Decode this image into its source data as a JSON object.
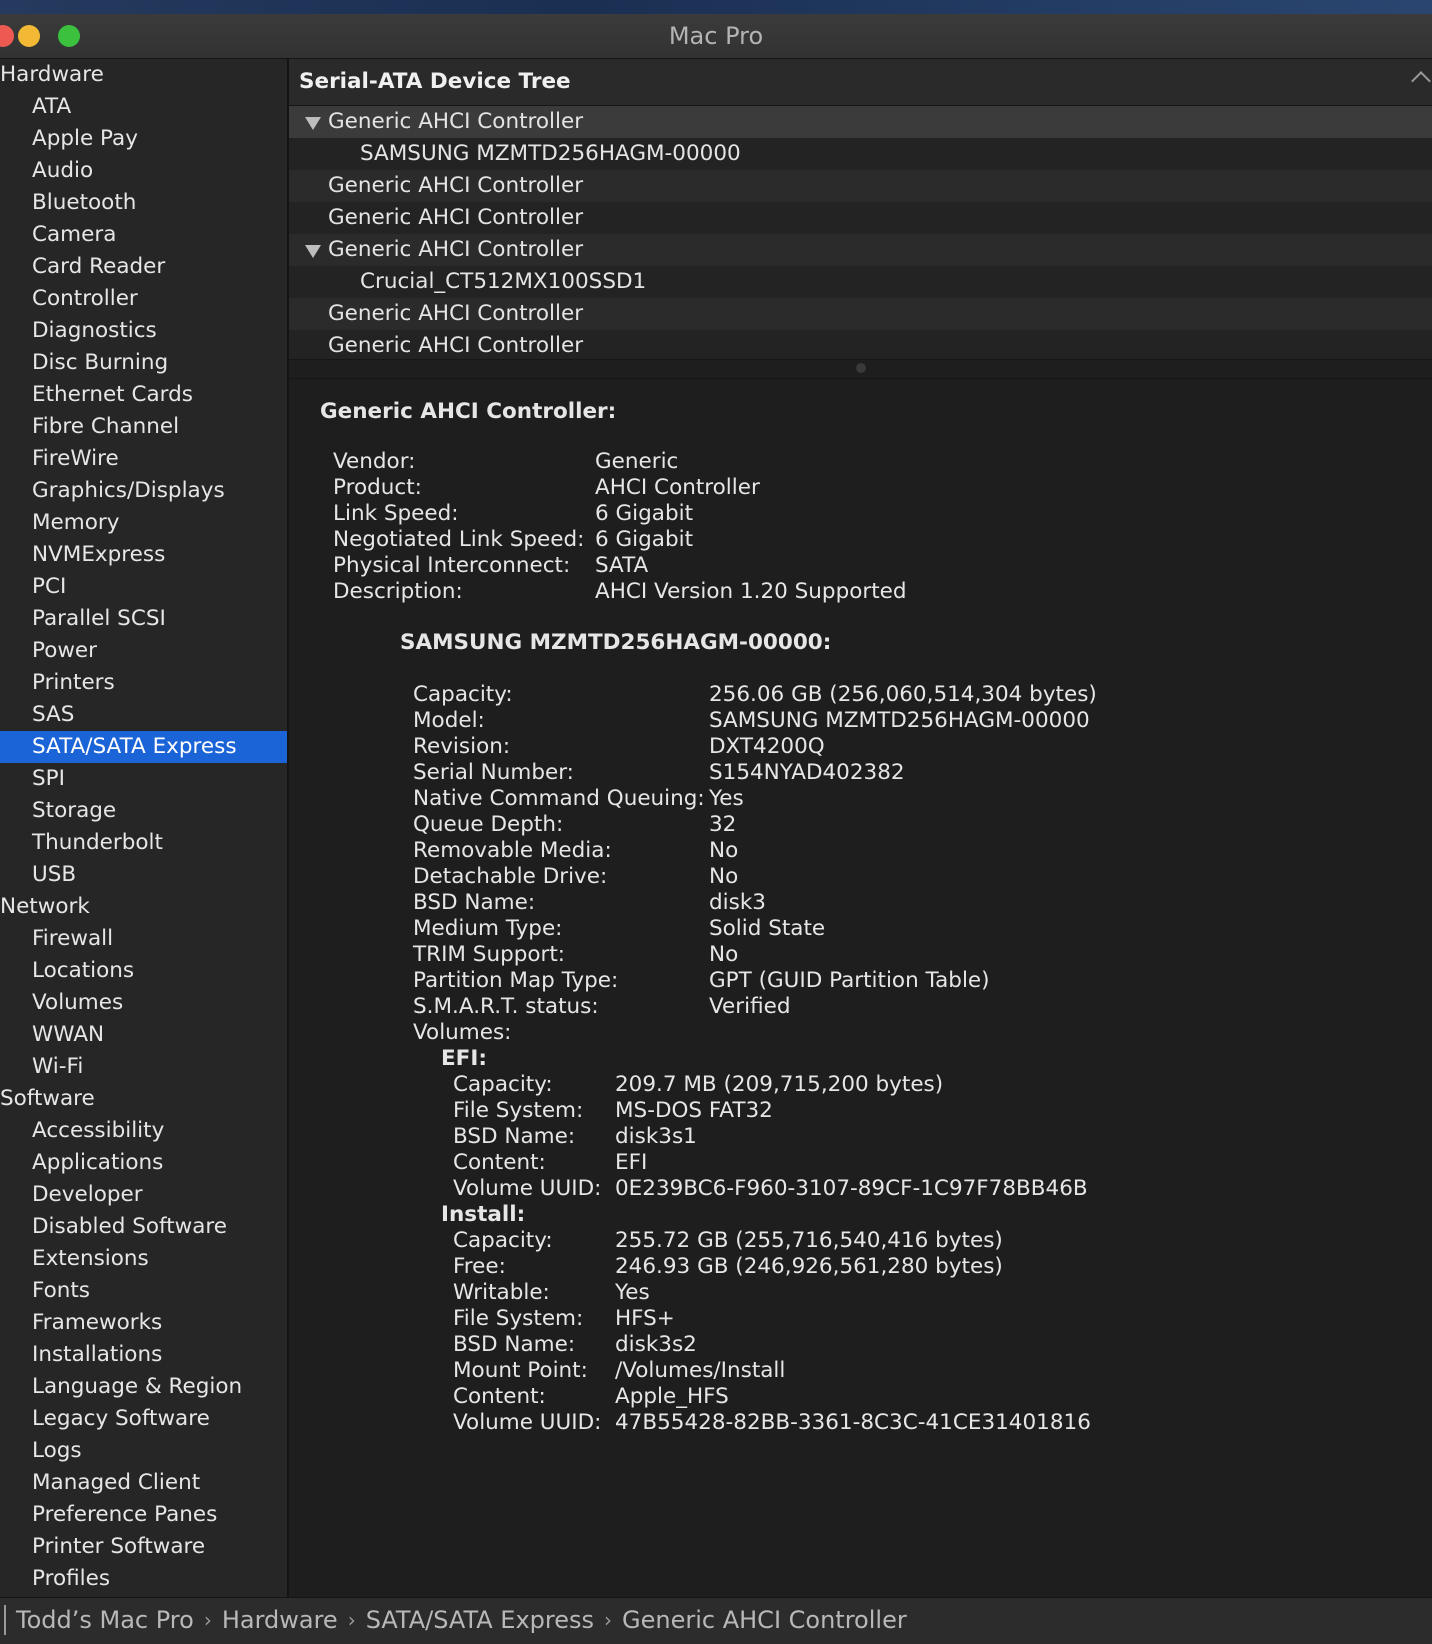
{
  "window": {
    "title": "Mac Pro"
  },
  "sidebar": {
    "groups": [
      {
        "label": "Hardware",
        "items": [
          "ATA",
          "Apple Pay",
          "Audio",
          "Bluetooth",
          "Camera",
          "Card Reader",
          "Controller",
          "Diagnostics",
          "Disc Burning",
          "Ethernet Cards",
          "Fibre Channel",
          "FireWire",
          "Graphics/Displays",
          "Memory",
          "NVMExpress",
          "PCI",
          "Parallel SCSI",
          "Power",
          "Printers",
          "SAS",
          "SATA/SATA Express",
          "SPI",
          "Storage",
          "Thunderbolt",
          "USB"
        ]
      },
      {
        "label": "Network",
        "items": [
          "Firewall",
          "Locations",
          "Volumes",
          "WWAN",
          "Wi-Fi"
        ]
      },
      {
        "label": "Software",
        "items": [
          "Accessibility",
          "Applications",
          "Developer",
          "Disabled Software",
          "Extensions",
          "Fonts",
          "Frameworks",
          "Installations",
          "Language & Region",
          "Legacy Software",
          "Logs",
          "Managed Client",
          "Preference Panes",
          "Printer Software",
          "Profiles"
        ]
      }
    ],
    "selected": "SATA/SATA Express"
  },
  "tree": {
    "header": "Serial-ATA Device Tree",
    "rows": [
      {
        "label": "Generic AHCI Controller",
        "level": 0,
        "expanded": true,
        "selected": true
      },
      {
        "label": "SAMSUNG MZMTD256HAGM-00000",
        "level": 1
      },
      {
        "label": "Generic AHCI Controller",
        "level": 0
      },
      {
        "label": "Generic AHCI Controller",
        "level": 0
      },
      {
        "label": "Generic AHCI Controller",
        "level": 0,
        "expanded": true
      },
      {
        "label": "Crucial_CT512MX100SSD1",
        "level": 1
      },
      {
        "label": "Generic AHCI Controller",
        "level": 0
      },
      {
        "label": "Generic AHCI Controller",
        "level": 0
      }
    ]
  },
  "detail": {
    "title": "Generic AHCI Controller:",
    "controller": [
      {
        "k": "Vendor:",
        "v": "Generic"
      },
      {
        "k": "Product:",
        "v": "AHCI Controller"
      },
      {
        "k": "Link Speed:",
        "v": "6 Gigabit"
      },
      {
        "k": "Negotiated Link Speed:",
        "v": "6 Gigabit"
      },
      {
        "k": "Physical Interconnect:",
        "v": "SATA"
      },
      {
        "k": "Description:",
        "v": "AHCI Version 1.20 Supported"
      }
    ],
    "drive_title": "SAMSUNG MZMTD256HAGM-00000:",
    "drive": [
      {
        "k": "Capacity:",
        "v": "256.06 GB (256,060,514,304 bytes)"
      },
      {
        "k": "Model:",
        "v": "SAMSUNG MZMTD256HAGM-00000"
      },
      {
        "k": "Revision:",
        "v": "DXT4200Q"
      },
      {
        "k": "Serial Number:",
        "v": "S154NYAD402382"
      },
      {
        "k": "Native Command Queuing:",
        "v": "Yes"
      },
      {
        "k": "Queue Depth:",
        "v": "32"
      },
      {
        "k": "Removable Media:",
        "v": "No"
      },
      {
        "k": "Detachable Drive:",
        "v": "No"
      },
      {
        "k": "BSD Name:",
        "v": "disk3"
      },
      {
        "k": "Medium Type:",
        "v": "Solid State"
      },
      {
        "k": "TRIM Support:",
        "v": "No"
      },
      {
        "k": "Partition Map Type:",
        "v": "GPT (GUID Partition Table)"
      },
      {
        "k": "S.M.A.R.T. status:",
        "v": "Verified"
      },
      {
        "k": "Volumes:",
        "v": ""
      }
    ],
    "volumes": [
      {
        "name": "EFI:",
        "fields": [
          {
            "k": "Capacity:",
            "v": "209.7 MB (209,715,200 bytes)"
          },
          {
            "k": "File System:",
            "v": "MS-DOS FAT32"
          },
          {
            "k": "BSD Name:",
            "v": "disk3s1"
          },
          {
            "k": "Content:",
            "v": "EFI"
          },
          {
            "k": "Volume UUID:",
            "v": "0E239BC6-F960-3107-89CF-1C97F78BB46B"
          }
        ]
      },
      {
        "name": "Install:",
        "fields": [
          {
            "k": "Capacity:",
            "v": "255.72 GB (255,716,540,416 bytes)"
          },
          {
            "k": "Free:",
            "v": "246.93 GB (246,926,561,280 bytes)"
          },
          {
            "k": "Writable:",
            "v": "Yes"
          },
          {
            "k": "File System:",
            "v": "HFS+"
          },
          {
            "k": "BSD Name:",
            "v": "disk3s2"
          },
          {
            "k": "Mount Point:",
            "v": "/Volumes/Install"
          },
          {
            "k": "Content:",
            "v": "Apple_HFS"
          },
          {
            "k": "Volume UUID:",
            "v": "47B55428-82BB-3361-8C3C-41CE31401816"
          }
        ]
      }
    ]
  },
  "breadcrumb": {
    "items": [
      "Todd’s Mac Pro",
      "Hardware",
      "SATA/SATA Express",
      "Generic AHCI Controller"
    ],
    "separator": "›"
  },
  "colors": {
    "selection": "#1b64d8",
    "background": "#1e1e1e",
    "sidebar": "#262626"
  }
}
